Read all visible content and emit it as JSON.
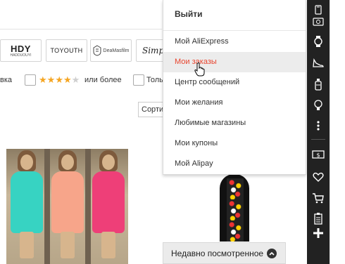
{
  "brands": {
    "hdy": "HDY",
    "hdy_sub": "HADDUOUYI",
    "toyouth": "TOYOUTH",
    "dm": "DeaMasfilm",
    "simp": "Simpl"
  },
  "filters": {
    "cut_label": "вка",
    "rating_suffix": "или более",
    "only_label": "Толь",
    "rating_value": 4
  },
  "sort": {
    "selected": "Сортир"
  },
  "menu": {
    "header": "Выйти",
    "items": [
      "Мой AliExpress",
      "Мои заказы",
      "Центр сообщений",
      "Мои желания",
      "Любимые магазины",
      "Мои купоны",
      "Мой Alipay"
    ],
    "hover_index": 1
  },
  "recent": {
    "label": "Недавно посмотренное"
  },
  "colors": {
    "accent": "#e8442e",
    "toolbar": "#222222",
    "star": "#f5a623"
  },
  "toolbar_icons": [
    "phone-icon",
    "coupon-icon",
    "watch-icon",
    "shoe-icon",
    "bottle-icon",
    "bulb-icon",
    "more-icon",
    "money-icon",
    "heart-icon",
    "cart-icon",
    "clipboard-icon",
    "plus-icon"
  ]
}
